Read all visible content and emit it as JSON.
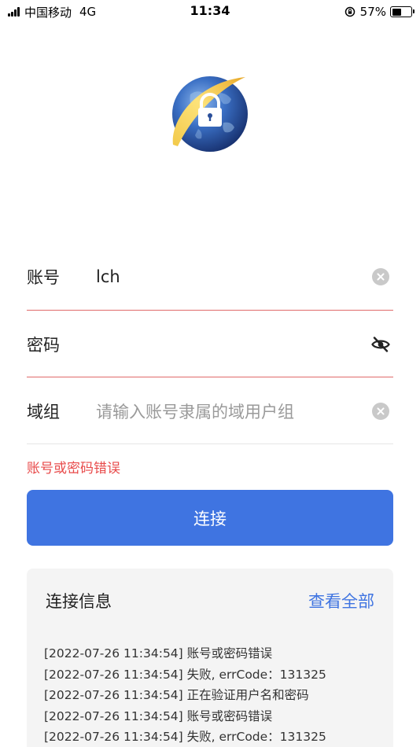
{
  "status_bar": {
    "carrier": "中国移动",
    "network": "4G",
    "time": "11:34",
    "battery_text": "57%",
    "battery_level": 0.57
  },
  "form": {
    "account": {
      "label": "账号",
      "value": "lch"
    },
    "password": {
      "label": "密码",
      "value": ""
    },
    "domain_group": {
      "label": "域组",
      "placeholder": "请输入账号隶属的域用户组"
    },
    "error_message": "账号或密码错误",
    "connect_label": "连接"
  },
  "connection_info": {
    "title": "连接信息",
    "view_all_label": "查看全部",
    "logs": [
      "[2022-07-26 11:34:54] 账号或密码错误",
      "[2022-07-26 11:34:54] 失败, errCode：131325",
      "[2022-07-26 11:34:54] 正在验证用户名和密码",
      "[2022-07-26 11:34:54] 账号或密码错误",
      "[2022-07-26 11:34:54] 失败, errCode：131325"
    ]
  },
  "colors": {
    "accent": "#3f74e1",
    "error": "#e84a4a",
    "underline_error": "#e06a6a"
  }
}
